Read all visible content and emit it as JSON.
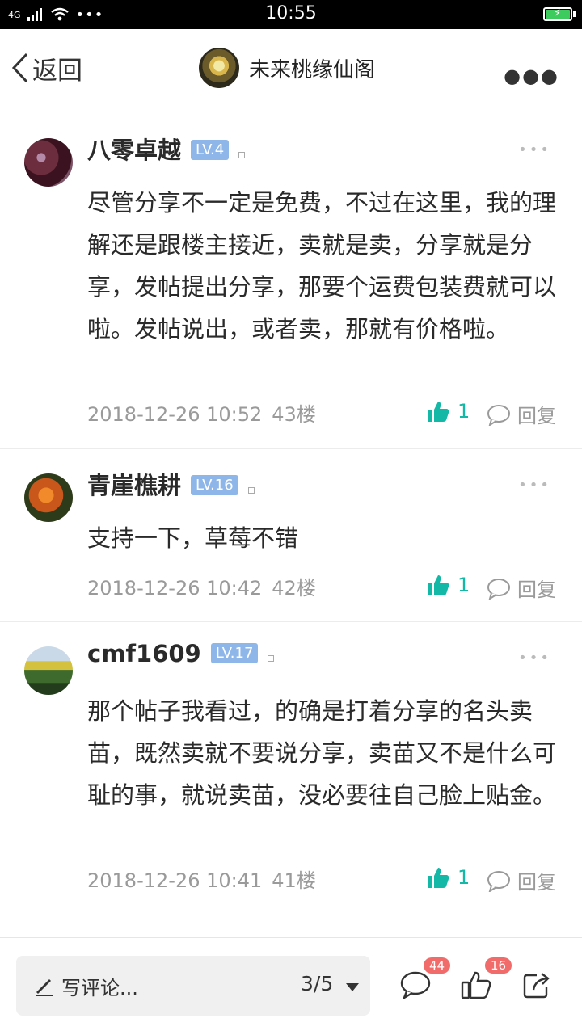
{
  "status": {
    "network": "4G",
    "time": "10:55"
  },
  "header": {
    "back_label": "返回",
    "group_name": "未来桃缘仙阁"
  },
  "comments": [
    {
      "username": "八零卓越",
      "level": "LV.4",
      "text": "尽管分享不一定是免费，不过在这里，我的理解还是跟楼主接近，卖就是卖，分享就是分享，发帖提出分享，那要个运费包装费就可以啦。发帖说出，或者卖，那就有价格啦。",
      "time": "2018-12-26 10:52",
      "floor": "43楼",
      "likes": "1",
      "reply_label": "回复"
    },
    {
      "username": "青崖樵耕",
      "level": "LV.16",
      "text": "支持一下，草莓不错",
      "time": "2018-12-26 10:42",
      "floor": "42楼",
      "likes": "1",
      "reply_label": "回复"
    },
    {
      "username": "cmf1609",
      "level": "LV.17",
      "text": "那个帖子我看过，的确是打着分享的名头卖苗，既然卖就不要说分享，卖苗又不是什么可耻的事，就说卖苗，没必要往自己脸上贴金。",
      "time": "2018-12-26 10:41",
      "floor": "41楼",
      "likes": "1",
      "reply_label": "回复"
    }
  ],
  "bottom": {
    "write_placeholder": "写评论...",
    "page_indicator": "3/5",
    "comment_count": "44",
    "like_count": "16"
  },
  "colors": {
    "accent": "#14b8a6",
    "level_badge": "#8fb6e8",
    "count_badge": "#f26b6b"
  }
}
